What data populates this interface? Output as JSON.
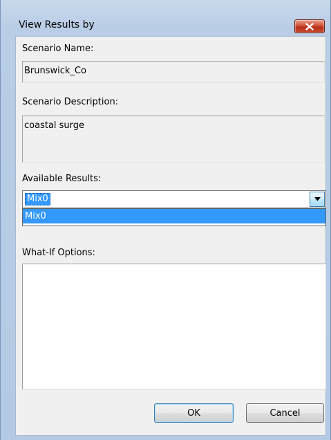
{
  "window": {
    "title": "View Results by",
    "close_icon": "close-icon"
  },
  "scenario_name": {
    "label": "Scenario Name:",
    "value": "Brunswick_Co"
  },
  "scenario_description": {
    "label": "Scenario Description:",
    "value": "coastal surge"
  },
  "available_results": {
    "label": "Available Results:",
    "selected": "Mix0",
    "options": [
      "Mix0"
    ],
    "arrow_icon": "chevron-down-icon"
  },
  "what_if_options": {
    "label": "What-If Options:",
    "value": ""
  },
  "buttons": {
    "ok": "OK",
    "cancel": "Cancel"
  },
  "colors": {
    "selection": "#3399ff",
    "close_button": "#c84a2e",
    "frame": "#b9cde6"
  }
}
